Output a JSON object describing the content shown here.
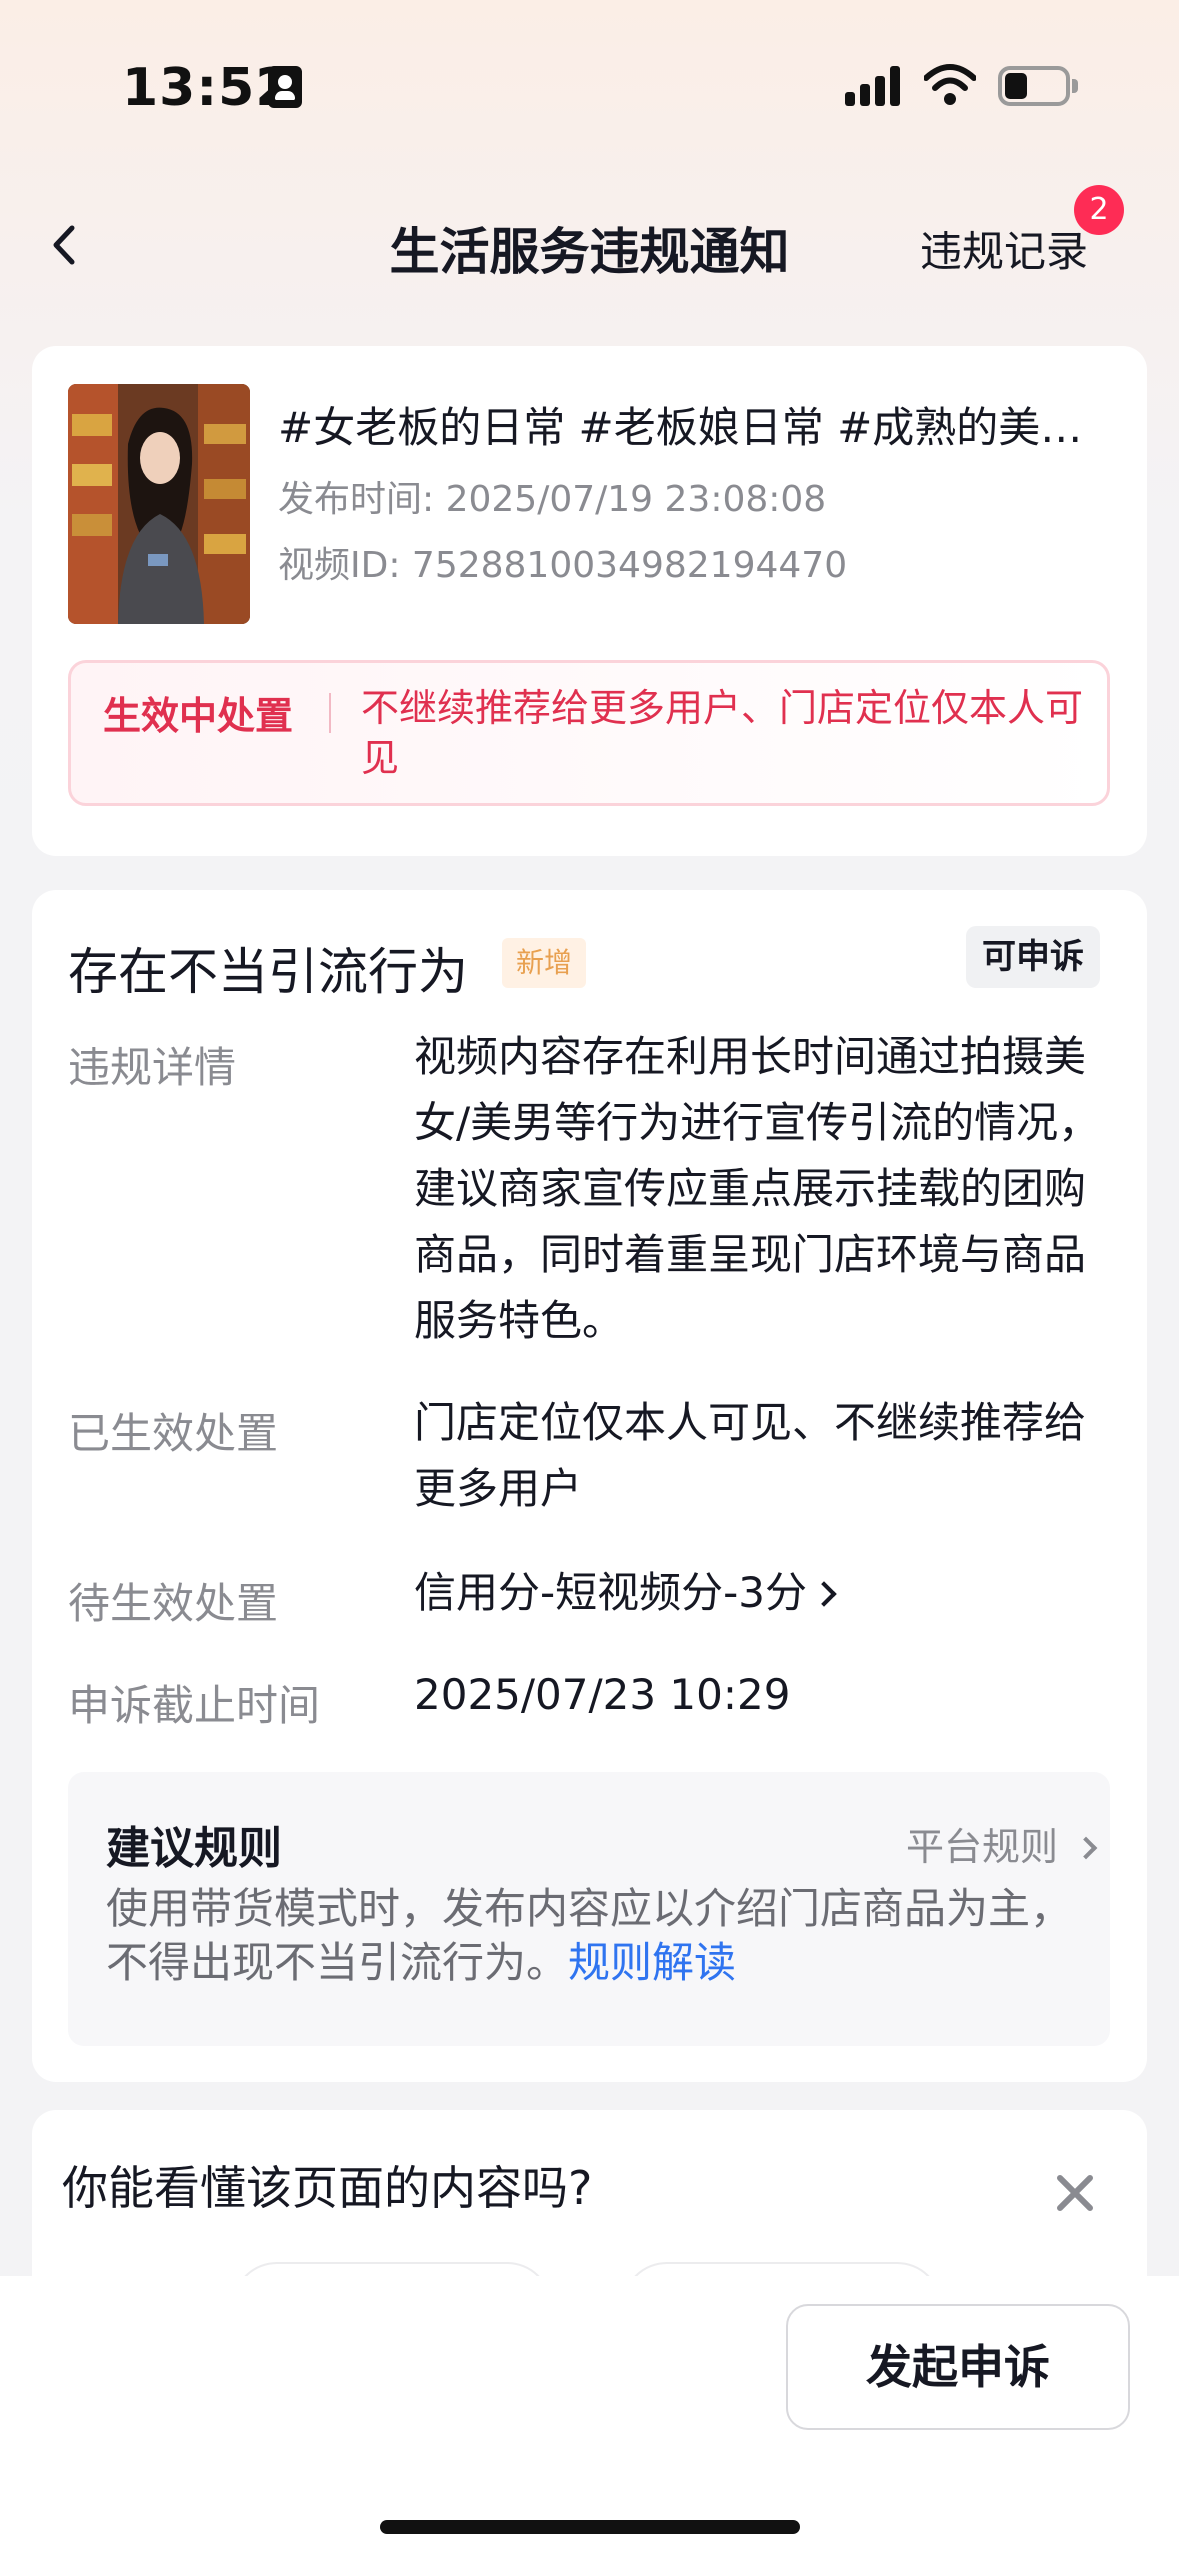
{
  "status_bar": {
    "time": "13:52",
    "icons": [
      "person-badge-icon",
      "signal-icon",
      "wifi-icon",
      "battery-icon"
    ]
  },
  "nav": {
    "back_icon": "chevron-left-icon",
    "title": "生活服务违规通知",
    "records_label": "违规记录",
    "records_badge": "2"
  },
  "video": {
    "title": "#女老板的日常 #老板娘日常 #成熟的美…",
    "publish_time": "发布时间: 2025/07/19 23:08:08",
    "video_id": "视频ID: 7528810034982194470",
    "status_tag": "生效中处置",
    "status_text": "不继续推荐给更多用户、门店定位仅本人可见"
  },
  "violation": {
    "title": "存在不当引流行为",
    "new_tag": "新增",
    "appeal_tag": "可申诉",
    "rows": [
      {
        "label": "违规详情",
        "value": "视频内容存在利用长时间通过拍摄美女/美男等行为进行宣传引流的情况，建议商家宣传应重点展示挂载的团购商品，同时着重呈现门店环境与商品服务特色。"
      },
      {
        "label": "已生效处置",
        "value": "门店定位仅本人可见、不继续推荐给更多用户"
      },
      {
        "label": "待生效处置",
        "value": "信用分-短视频分-3分"
      },
      {
        "label": "申诉截止时间",
        "value": "2025/07/23 10:29"
      }
    ],
    "rule": {
      "title": "建议规则",
      "link": "平台规则",
      "text": "使用带货模式时，发布内容应以介绍门店商品为主，不得出现不当引流行为。",
      "read_link": "规则解读"
    }
  },
  "survey": {
    "question": "你能看懂该页面的内容吗?",
    "close_icon": "close-icon"
  },
  "bottom": {
    "appeal_button": "发起申诉"
  },
  "colors": {
    "accent_red": "#fe2c55",
    "status_red": "#e0304f",
    "link_blue": "#2f74f0",
    "new_tag": "#e8a050"
  }
}
